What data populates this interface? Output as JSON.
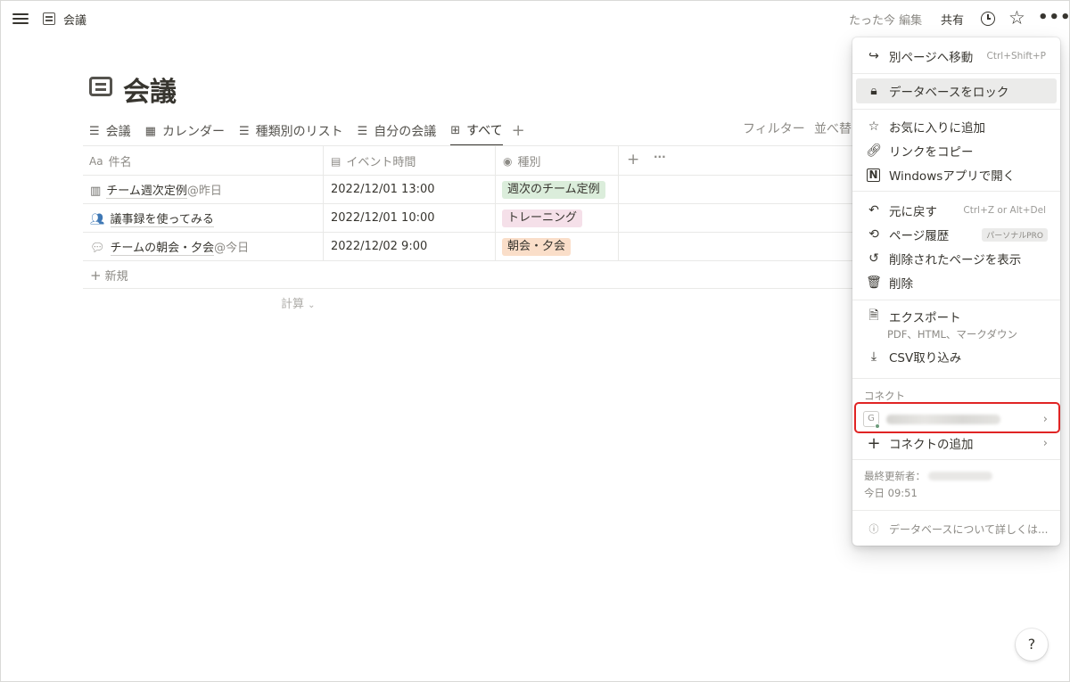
{
  "topbar": {
    "title": "会議",
    "edited": "たった今 編集",
    "share": "共有"
  },
  "page": {
    "title": "会議"
  },
  "tabs": [
    {
      "label": "会議",
      "icon": "list-icon"
    },
    {
      "label": "カレンダー",
      "icon": "calendar-icon"
    },
    {
      "label": "種類別のリスト",
      "icon": "list-icon"
    },
    {
      "label": "自分の会議",
      "icon": "list-icon"
    },
    {
      "label": "すべて",
      "icon": "table-icon",
      "active": true
    }
  ],
  "toolbar": {
    "filter": "フィルター",
    "sort": "並べ替え"
  },
  "table": {
    "headers": [
      {
        "label": "件名",
        "icon": "Aa"
      },
      {
        "label": "イベント時間",
        "icon": "calendar-icon"
      },
      {
        "label": "種別",
        "icon": "select-icon"
      }
    ],
    "rows": [
      {
        "title": "チーム週次定例",
        "mention": "@昨日",
        "time": "2022/12/01 13:00",
        "tag": "週次のチーム定例",
        "tag_bg": "#dbeddb",
        "icon": "calendar-grid-icon"
      },
      {
        "title": "議事録を使ってみる",
        "mention": "",
        "time": "2022/12/01 10:00",
        "tag": "トレーニング",
        "tag_bg": "#f5e0e9",
        "icon": "people-icon"
      },
      {
        "title": "チームの朝会・夕会",
        "mention": "@今日",
        "time": "2022/12/02 9:00",
        "tag": "朝会・夕会",
        "tag_bg": "#fadec9",
        "icon": "chat-bubbles-icon"
      }
    ],
    "new_label": "新規",
    "calc_label": "計算"
  },
  "menu": {
    "move": {
      "label": "別ページへ移動",
      "shortcut": "Ctrl+Shift+P"
    },
    "lock": {
      "label": "データベースをロック"
    },
    "favorite": {
      "label": "お気に入りに追加"
    },
    "copy_link": {
      "label": "リンクをコピー"
    },
    "open_app": {
      "label": "Windowsアプリで開く"
    },
    "undo": {
      "label": "元に戻す",
      "shortcut": "Ctrl+Z or Alt+Del"
    },
    "history": {
      "label": "ページ履歴",
      "badge": "パーソナルPRO"
    },
    "show_deleted": {
      "label": "削除されたページを表示"
    },
    "delete": {
      "label": "削除"
    },
    "export": {
      "label": "エクスポート",
      "sub": "PDF、HTML、マークダウン"
    },
    "csv": {
      "label": "CSV取り込み"
    },
    "connect_header": "コネクト",
    "connect_item_glyph": "G",
    "add_connect": {
      "label": "コネクトの追加"
    },
    "last_edited_by": "最終更新者：",
    "last_edited_time": "今日 09:51",
    "learn_more": "データベースについて詳しくは..."
  },
  "help": "?"
}
